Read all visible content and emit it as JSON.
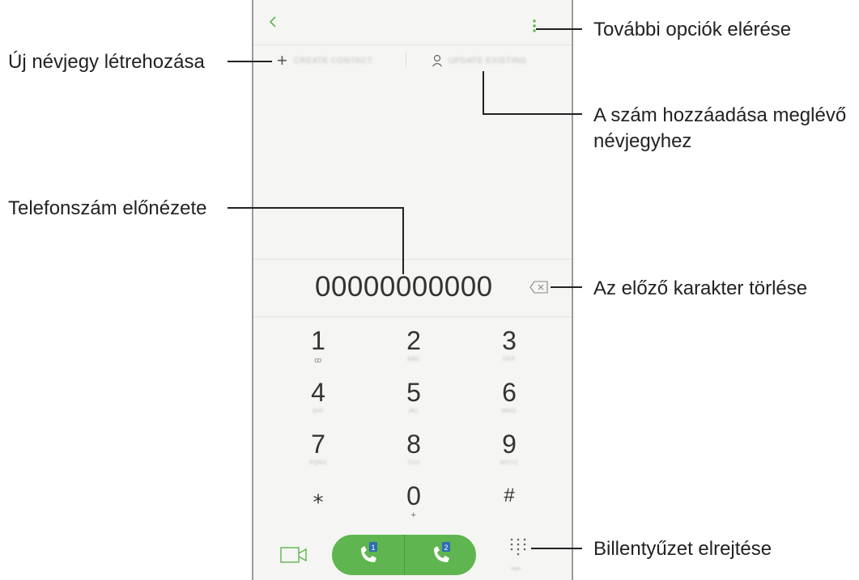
{
  "callouts": {
    "more_options": "További opciók elérése",
    "new_contact": "Új névjegy létrehozása",
    "add_to_existing_line1": "A szám hozzáadása meglévő",
    "add_to_existing_line2": "névjegyhez",
    "number_preview": "Telefonszám előnézete",
    "delete_char": "Az előző karakter törlése",
    "hide_keypad": "Billentyűzet elrejtése"
  },
  "screen": {
    "create_contact_label": "CREATE CONTACT",
    "update_existing_label": "UPDATE EXISTING",
    "number": "00000000000",
    "hide_label": "Hide",
    "keys": [
      {
        "digit": "1",
        "sub": "ꝏ"
      },
      {
        "digit": "2",
        "sub": "ABC"
      },
      {
        "digit": "3",
        "sub": "DEF"
      },
      {
        "digit": "4",
        "sub": "GHI"
      },
      {
        "digit": "5",
        "sub": "JKL"
      },
      {
        "digit": "6",
        "sub": "MNO"
      },
      {
        "digit": "7",
        "sub": "PQRS"
      },
      {
        "digit": "8",
        "sub": "TUV"
      },
      {
        "digit": "9",
        "sub": "WXYZ"
      },
      {
        "digit": "⁎",
        "sub": ""
      },
      {
        "digit": "0",
        "sub": "+"
      },
      {
        "digit": "#",
        "sub": ""
      }
    ],
    "sim1_label": "1",
    "sim2_label": "2"
  },
  "icons": {
    "back": "chevron-left-icon",
    "more": "more-vertical-icon",
    "add": "plus-icon",
    "person": "person-icon",
    "backspace": "backspace-icon",
    "video": "video-call-icon",
    "call": "phone-call-icon",
    "dialpad": "dialpad-icon"
  },
  "colors": {
    "accent": "#5fb550",
    "sim_badge": "#2e6db4"
  }
}
